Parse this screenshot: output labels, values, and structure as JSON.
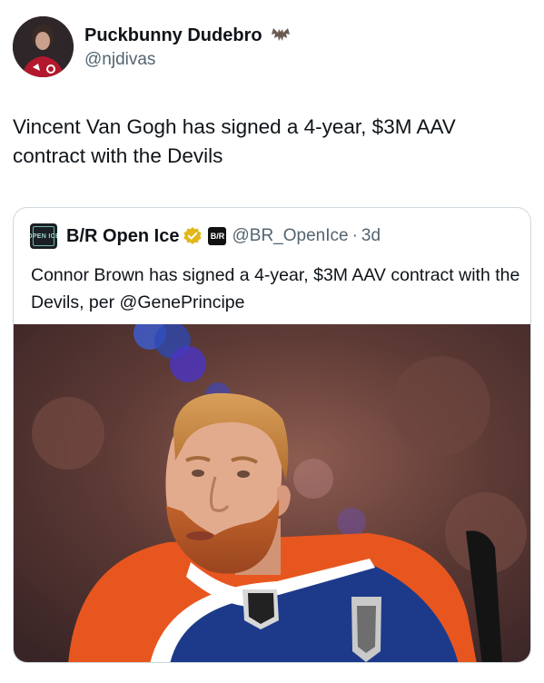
{
  "author": {
    "display_name": "Puckbunny Dudebro",
    "handle": "@njdivas",
    "name_emoji": "bat-emoji"
  },
  "tweet": {
    "text": "Vincent Van Gogh has signed a 4-year, $3M AAV contract with the Devils"
  },
  "quoted": {
    "display_name": "B/R Open Ice",
    "avatar_text": "OPEN ICE",
    "affiliate_badge": "B/R",
    "handle": "@BR_OpenIce",
    "separator": "·",
    "timestamp": "3d",
    "text": "Connor Brown has signed a 4-year, $3M AAV contract with the Devils, per @GenePrincipe",
    "media": "hockey-player-photo"
  },
  "colors": {
    "text_primary": "#0f1419",
    "text_secondary": "#536471",
    "border": "#cfd9de",
    "verified_gold": "#e2b719",
    "jersey_orange": "#f15a22",
    "jersey_blue": "#1d3a8a"
  }
}
